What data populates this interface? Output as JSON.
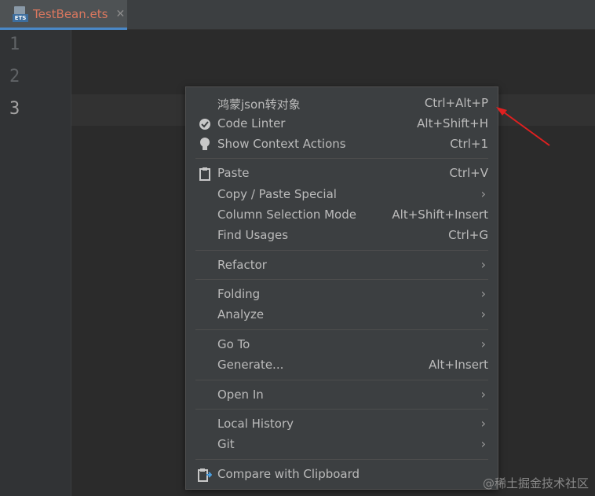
{
  "tab": {
    "title": "TestBean.ets",
    "icon_badge": "ETS",
    "close_glyph": "✕",
    "title_color": "#d9775f"
  },
  "gutter": {
    "lines": [
      "1",
      "2",
      "3"
    ]
  },
  "menu": {
    "items": [
      {
        "label": "鸿蒙json转对象",
        "shortcut": "Ctrl+Alt+P",
        "icon": ""
      },
      {
        "label": "Code Linter",
        "shortcut": "Alt+Shift+H",
        "icon": "code-linter-icon"
      },
      {
        "label": "Show Context Actions",
        "shortcut": "Ctrl+1",
        "icon": "lightbulb-icon"
      },
      {
        "label": "Paste",
        "shortcut": "Ctrl+V",
        "icon": "clipboard-icon"
      },
      {
        "label": "Copy / Paste Special",
        "shortcut": "",
        "icon": "",
        "submenu": true
      },
      {
        "label": "Column Selection Mode",
        "shortcut": "Alt+Shift+Insert",
        "icon": ""
      },
      {
        "label": "Find Usages",
        "shortcut": "Ctrl+G",
        "icon": ""
      },
      {
        "label": "Refactor",
        "shortcut": "",
        "icon": "",
        "submenu": true
      },
      {
        "label": "Folding",
        "shortcut": "",
        "icon": "",
        "submenu": true
      },
      {
        "label": "Analyze",
        "shortcut": "",
        "icon": "",
        "submenu": true
      },
      {
        "label": "Go To",
        "shortcut": "",
        "icon": "",
        "submenu": true
      },
      {
        "label": "Generate...",
        "shortcut": "Alt+Insert",
        "icon": ""
      },
      {
        "label": "Open In",
        "shortcut": "",
        "icon": "",
        "submenu": true
      },
      {
        "label": "Local History",
        "shortcut": "",
        "icon": "",
        "submenu": true
      },
      {
        "label": "Git",
        "shortcut": "",
        "icon": "",
        "submenu": true
      },
      {
        "label": "Compare with Clipboard",
        "shortcut": "",
        "icon": "compare-clipboard-icon"
      }
    ],
    "chevron": "›"
  },
  "watermark": "@稀土掘金技术社区",
  "colors": {
    "editor_bg": "#2b2b2b",
    "menu_bg": "#3c3f41",
    "annotation_arrow": "#e02020"
  }
}
